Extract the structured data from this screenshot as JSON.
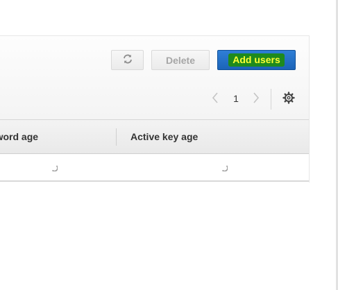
{
  "toolbar": {
    "refresh_icon": "refresh-icon",
    "delete_label": "Delete",
    "add_label": "Add users",
    "colors": {
      "add_button_bg": "#1f6bc2",
      "add_label_highlight": "#1e8a1e",
      "add_label_text": "#ffff33",
      "delete_text_disabled": "#a6a6a6"
    }
  },
  "pagination": {
    "prev_icon": "chevron-left-icon",
    "page": "1",
    "next_icon": "chevron-right-icon",
    "settings_icon": "gear-icon"
  },
  "table": {
    "columns": [
      {
        "label": "ssword age"
      },
      {
        "label": "Active key age"
      }
    ],
    "rows": [
      {
        "cells": [
          "loading-spinner",
          "loading-spinner"
        ]
      }
    ]
  }
}
